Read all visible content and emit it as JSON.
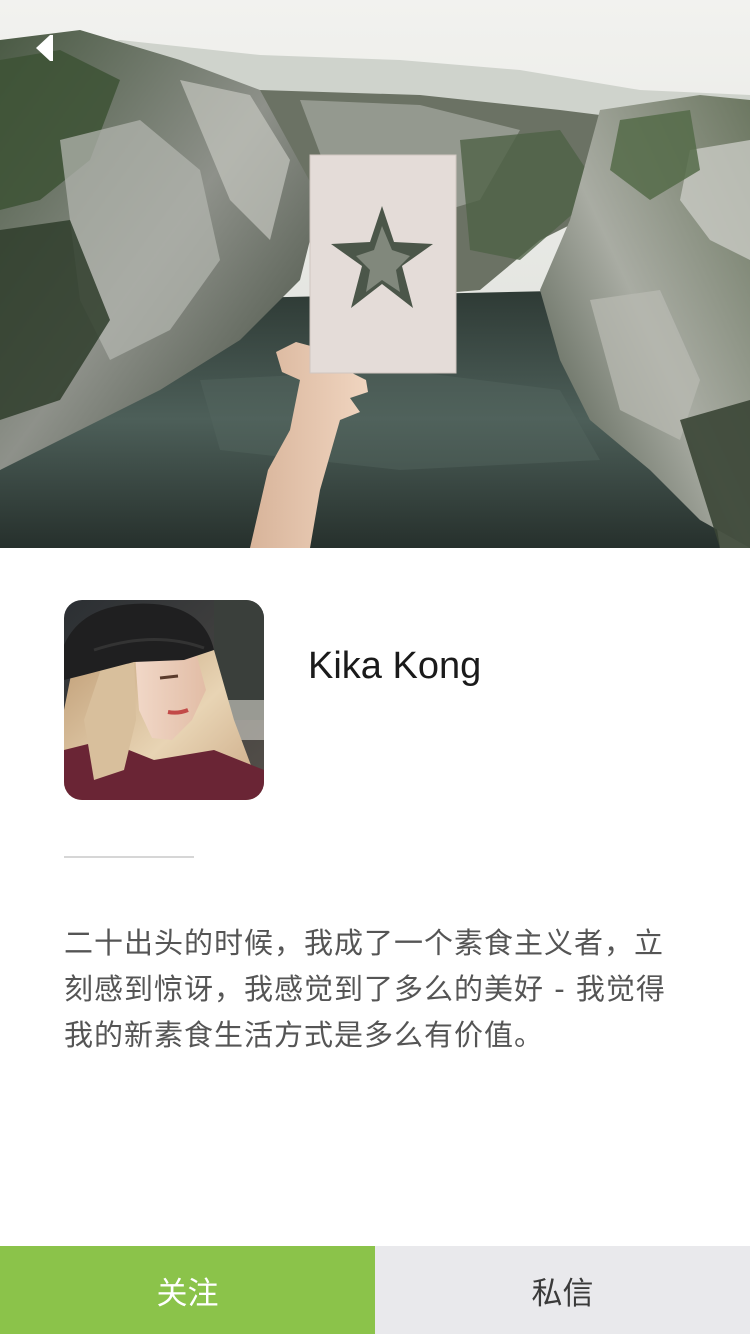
{
  "nav": {
    "back_icon": "chevron-left-icon"
  },
  "hero": {
    "description_icon": "landscape-photo"
  },
  "profile": {
    "name": "Kika Kong",
    "bio": "二十出头的时候，我成了一个素食主义者，立刻感到惊讶，我感觉到了多么的美好 - 我觉得我的新素食生活方式是多么有价值。"
  },
  "actions": {
    "follow_label": "关注",
    "message_label": "私信"
  },
  "colors": {
    "follow": "#8bc34a",
    "message": "#e9e9ec",
    "name_text": "#1a1a1a",
    "bio_text": "#555555"
  }
}
